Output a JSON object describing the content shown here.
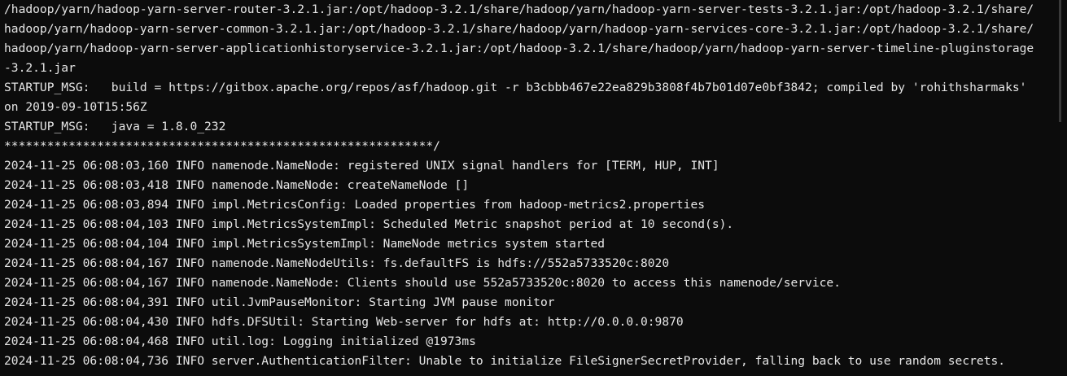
{
  "terminal": {
    "lines": [
      "/hadoop/yarn/hadoop-yarn-server-router-3.2.1.jar:/opt/hadoop-3.2.1/share/hadoop/yarn/hadoop-yarn-server-tests-3.2.1.jar:/opt/hadoop-3.2.1/share/",
      "hadoop/yarn/hadoop-yarn-server-common-3.2.1.jar:/opt/hadoop-3.2.1/share/hadoop/yarn/hadoop-yarn-services-core-3.2.1.jar:/opt/hadoop-3.2.1/share/",
      "hadoop/yarn/hadoop-yarn-server-applicationhistoryservice-3.2.1.jar:/opt/hadoop-3.2.1/share/hadoop/yarn/hadoop-yarn-server-timeline-pluginstorage",
      "-3.2.1.jar",
      "STARTUP_MSG:   build = https://gitbox.apache.org/repos/asf/hadoop.git -r b3cbbb467e22ea829b3808f4b7b01d07e0bf3842; compiled by 'rohithsharmaks'",
      "on 2019-09-10T15:56Z",
      "STARTUP_MSG:   java = 1.8.0_232",
      "************************************************************/",
      "2024-11-25 06:08:03,160 INFO namenode.NameNode: registered UNIX signal handlers for [TERM, HUP, INT]",
      "2024-11-25 06:08:03,418 INFO namenode.NameNode: createNameNode []",
      "2024-11-25 06:08:03,894 INFO impl.MetricsConfig: Loaded properties from hadoop-metrics2.properties",
      "2024-11-25 06:08:04,103 INFO impl.MetricsSystemImpl: Scheduled Metric snapshot period at 10 second(s).",
      "2024-11-25 06:08:04,104 INFO impl.MetricsSystemImpl: NameNode metrics system started",
      "2024-11-25 06:08:04,167 INFO namenode.NameNodeUtils: fs.defaultFS is hdfs://552a5733520c:8020",
      "2024-11-25 06:08:04,167 INFO namenode.NameNode: Clients should use 552a5733520c:8020 to access this namenode/service.",
      "2024-11-25 06:08:04,391 INFO util.JvmPauseMonitor: Starting JVM pause monitor",
      "2024-11-25 06:08:04,430 INFO hdfs.DFSUtil: Starting Web-server for hdfs at: http://0.0.0.0:9870",
      "2024-11-25 06:08:04,468 INFO util.log: Logging initialized @1973ms",
      "2024-11-25 06:08:04,736 INFO server.AuthenticationFilter: Unable to initialize FileSignerSecretProvider, falling back to use random secrets."
    ]
  },
  "colors": {
    "background": "#0c0c0c",
    "text": "#e6e6e6"
  }
}
